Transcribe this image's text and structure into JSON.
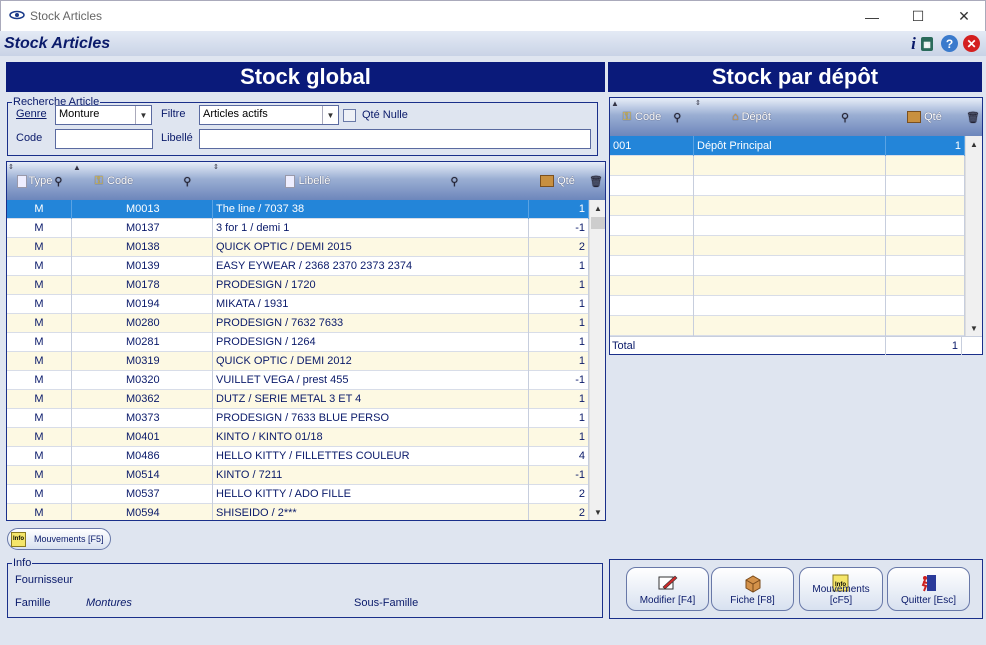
{
  "window": {
    "title": "Stock Articles"
  },
  "header": {
    "app_title": "Stock Articles"
  },
  "left": {
    "band_title": "Stock global",
    "search": {
      "legend": "Recherche Article",
      "genre_label": "Genre",
      "genre_value": "Monture",
      "filtre_label": "Filtre",
      "filtre_value": "Articles actifs",
      "qte_nulle_label": "Qté Nulle",
      "code_label": "Code",
      "code_value": "",
      "libelle_label": "Libellé",
      "libelle_value": ""
    },
    "columns": {
      "type": "Type",
      "code": "Code",
      "libelle": "Libellé",
      "qte": "Qté"
    },
    "rows": [
      {
        "type": "M",
        "code": "M0013",
        "libelle": "The line / 7037 38",
        "qte": "1"
      },
      {
        "type": "M",
        "code": "M0137",
        "libelle": "3 for 1 / demi 1",
        "qte": "-1"
      },
      {
        "type": "M",
        "code": "M0138",
        "libelle": "QUICK OPTIC / DEMI 2015",
        "qte": "2"
      },
      {
        "type": "M",
        "code": "M0139",
        "libelle": "EASY EYWEAR / 2368 2370 2373 2374",
        "qte": "1"
      },
      {
        "type": "M",
        "code": "M0178",
        "libelle": "PRODESIGN / 1720",
        "qte": "1"
      },
      {
        "type": "M",
        "code": "M0194",
        "libelle": "MIKATA / 1931",
        "qte": "1"
      },
      {
        "type": "M",
        "code": "M0280",
        "libelle": "PRODESIGN / 7632 7633",
        "qte": "1"
      },
      {
        "type": "M",
        "code": "M0281",
        "libelle": "PRODESIGN / 1264",
        "qte": "1"
      },
      {
        "type": "M",
        "code": "M0319",
        "libelle": "QUICK OPTIC / DEMI 2012",
        "qte": "1"
      },
      {
        "type": "M",
        "code": "M0320",
        "libelle": "VUILLET VEGA / prest 455",
        "qte": "-1"
      },
      {
        "type": "M",
        "code": "M0362",
        "libelle": "DUTZ / SERIE METAL 3 ET 4",
        "qte": "1"
      },
      {
        "type": "M",
        "code": "M0373",
        "libelle": "PRODESIGN / 7633 BLUE PERSO",
        "qte": "1"
      },
      {
        "type": "M",
        "code": "M0401",
        "libelle": "KINTO / KINTO 01/18",
        "qte": "1"
      },
      {
        "type": "M",
        "code": "M0486",
        "libelle": "HELLO KITTY / FILLETTES COULEUR",
        "qte": "4"
      },
      {
        "type": "M",
        "code": "M0514",
        "libelle": "KINTO / 7211",
        "qte": "-1"
      },
      {
        "type": "M",
        "code": "M0537",
        "libelle": "HELLO KITTY / ADO FILLE",
        "qte": "2"
      },
      {
        "type": "M",
        "code": "M0594",
        "libelle": "SHISEIDO / 2***",
        "qte": "2"
      }
    ],
    "mouvements_button": "Mouvements [F5]"
  },
  "info": {
    "legend": "Info",
    "fournisseur_label": "Fournisseur",
    "famille_label": "Famille",
    "famille_value": "Montures",
    "sous_famille_label": "Sous-Famille"
  },
  "right": {
    "band_title": "Stock par dépôt",
    "columns": {
      "code": "Code",
      "depot": "Dépôt",
      "qte": "Qté"
    },
    "rows": [
      {
        "code": "001",
        "depot": "Dépôt Principal",
        "qte": "1"
      }
    ],
    "total_label": "Total",
    "total_value": "1"
  },
  "actions": {
    "modifier": "Modifier [F4]",
    "fiche": "Fiche [F8]",
    "mouvements": "Mouvements [cF5]",
    "quitter": "Quitter [Esc]"
  },
  "colors": {
    "band": "#0a1a7a",
    "selection": "#2385d9",
    "odd_row": "#fdf9e3"
  }
}
